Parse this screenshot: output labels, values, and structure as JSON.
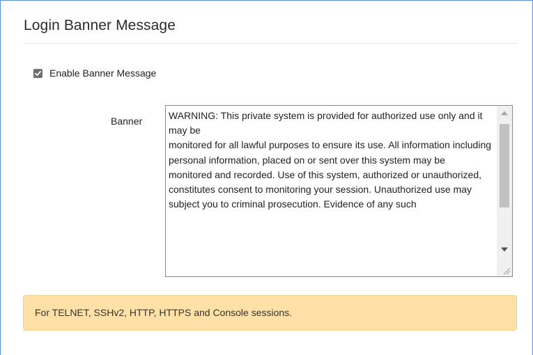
{
  "panel": {
    "title": "Login Banner Message"
  },
  "enable_banner": {
    "label": "Enable Banner Message",
    "checked": true
  },
  "banner_field": {
    "label": "Banner",
    "value": "WARNING: This private system is provided for authorized use only and it may be\nmonitored for all lawful purposes to ensure its use. All information including personal information, placed on or sent over this system may be\nmonitored and recorded. Use of this system, authorized or unauthorized,\nconstitutes consent to monitoring your session. Unauthorized use may\nsubject you to criminal prosecution. Evidence of any such"
  },
  "notice": {
    "text": "For TELNET, SSHv2, HTTP, HTTPS and Console sessions."
  },
  "colors": {
    "notice_background": "#ffe0a6",
    "checkbox_fill": "#707070",
    "frame_border": "#5b8fd6"
  }
}
